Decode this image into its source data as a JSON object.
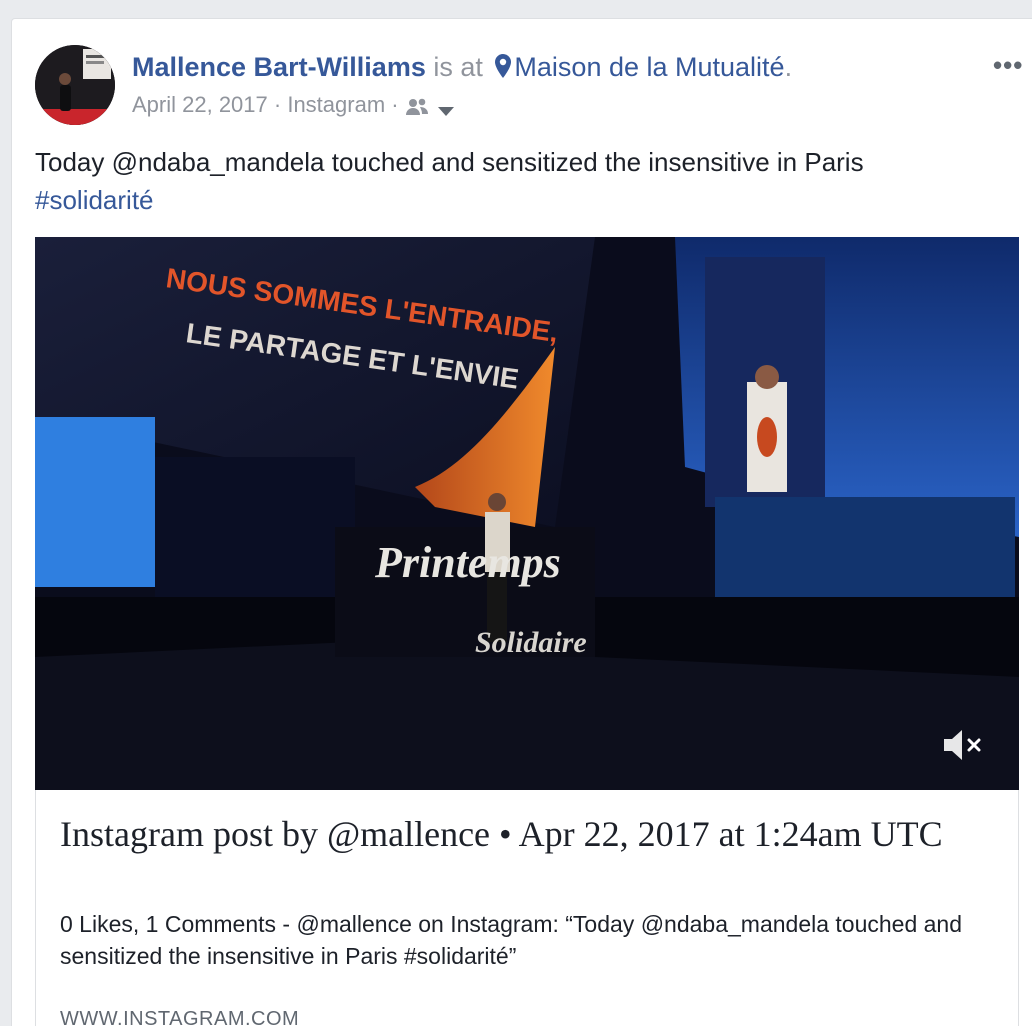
{
  "post": {
    "author": "Mallence Bart-Williams",
    "is_at": "is at",
    "place": "Maison de la Mutualité",
    "period": ".",
    "date": "April 22, 2017",
    "sep": " · ",
    "source": "Instagram",
    "sep2": " · ",
    "more_label": "•••",
    "text": "Today @ndaba_mandela touched and sensitized the insensitive in Paris",
    "hashtag": "#solidarité",
    "icons": {
      "location": "location-pin-icon",
      "audience": "friends-audience-icon",
      "dropdown": "chevron-down-icon",
      "mute": "speaker-muted-icon"
    },
    "video_overlay": {
      "screen_line1": "NOUS SOMMES L'ENTRAIDE,",
      "screen_line2": "LE PARTAGE ET L'ENVIE",
      "stage_logo1": "Printemps",
      "stage_logo2": "Solidaire"
    }
  },
  "link_preview": {
    "title": "Instagram post by @mallence • Apr 22, 2017 at 1:24am UTC",
    "description": "0 Likes, 1 Comments - @mallence on Instagram: “Today @ndaba_mandela touched and sensitized the insensitive in Paris #solidarité”",
    "domain": "WWW.INSTAGRAM.COM"
  },
  "colors": {
    "link": "#365899",
    "meta": "#90949c",
    "text": "#1d2129",
    "border": "#dddfe2"
  }
}
